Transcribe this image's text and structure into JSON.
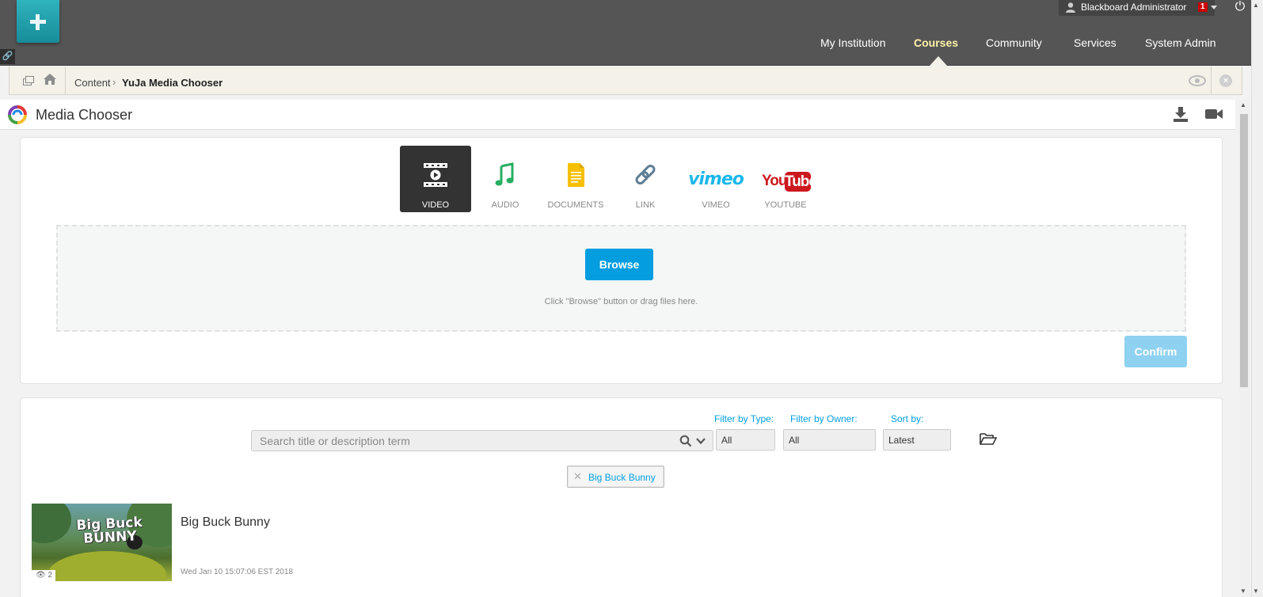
{
  "topbar": {
    "user_name": "Blackboard Administrator",
    "notification_count": "1",
    "nav": [
      "My Institution",
      "Courses",
      "Community",
      "Services",
      "System Admin"
    ],
    "active_nav": "Courses"
  },
  "breadcrumb": {
    "items": [
      "Content",
      "YuJa Media Chooser"
    ]
  },
  "media_chooser": {
    "title": "Media Chooser",
    "tabs": [
      {
        "label": "VIDEO",
        "icon": "video-icon",
        "active": true
      },
      {
        "label": "AUDIO",
        "icon": "music-icon",
        "active": false
      },
      {
        "label": "DOCUMENTS",
        "icon": "document-icon",
        "active": false
      },
      {
        "label": "LINK",
        "icon": "link-icon",
        "active": false
      },
      {
        "label": "VIMEO",
        "icon": "vimeo-logo",
        "active": false
      },
      {
        "label": "YOUTUBE",
        "icon": "youtube-logo",
        "active": false
      }
    ],
    "vimeo_logo_text": "vimeo",
    "youtube_logo_text": {
      "you": "You",
      "tube": "Tube"
    },
    "browse_label": "Browse",
    "drop_hint": "Click \"Browse\" button or drag files here.",
    "confirm_label": "Confirm"
  },
  "library": {
    "search_placeholder": "Search title or description term",
    "filter_type_label": "Filter by Type:",
    "filter_type_value": "All",
    "filter_owner_label": "Filter by Owner:",
    "filter_owner_value": "All",
    "sort_label": "Sort by:",
    "sort_value": "Latest",
    "chip_label": "Big Buck Bunny",
    "items": [
      {
        "title": "Big Buck Bunny",
        "thumb_text": [
          "Big Buck",
          "BUNNY"
        ],
        "views": "2",
        "date": "Wed Jan 10 15:07:06 EST 2018"
      }
    ]
  },
  "colors": {
    "topbar": "#555555",
    "accent": "#049ee0",
    "confirm_disabled": "#8fd1f0",
    "active_nav": "#fff2a8",
    "active_tab": "#333333"
  }
}
